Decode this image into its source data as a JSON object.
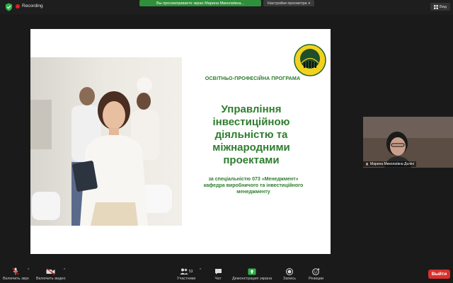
{
  "topbar": {
    "recording_label": "Recording",
    "share_banner": "Вы просматриваете экран Марина Миколаївна...",
    "share_settings": "Настройки просмотра",
    "view_label": "Вид"
  },
  "slide": {
    "program": "ОСВІТНЬО-ПРОФЕСІЙНА ПРОГРАМА",
    "title_lines": [
      "Управління",
      "інвестиційною",
      "діяльністю та",
      "міжнародними",
      "проектами"
    ],
    "subtitle_lines": [
      "за спеціальністю 073 «Менеджмент»",
      "кафедра виробничого та інвестиційного",
      "менеджменту"
    ]
  },
  "participant": {
    "name": "Марина Миколаївна Дєліні"
  },
  "toolbar": {
    "mute_label": "Включить звук",
    "video_label": "Включить видео",
    "participants_label": "Участники",
    "participants_count": "53",
    "chat_label": "Чат",
    "share_label": "Демонстрация экрана",
    "record_label": "Запись",
    "reactions_label": "Реакции",
    "leave_label": "Выйти"
  },
  "colors": {
    "banner_green": "#2f8f3a",
    "slide_green": "#2e7d2e",
    "leave_red": "#d9302c",
    "share_icon_green": "#2fb34a"
  }
}
